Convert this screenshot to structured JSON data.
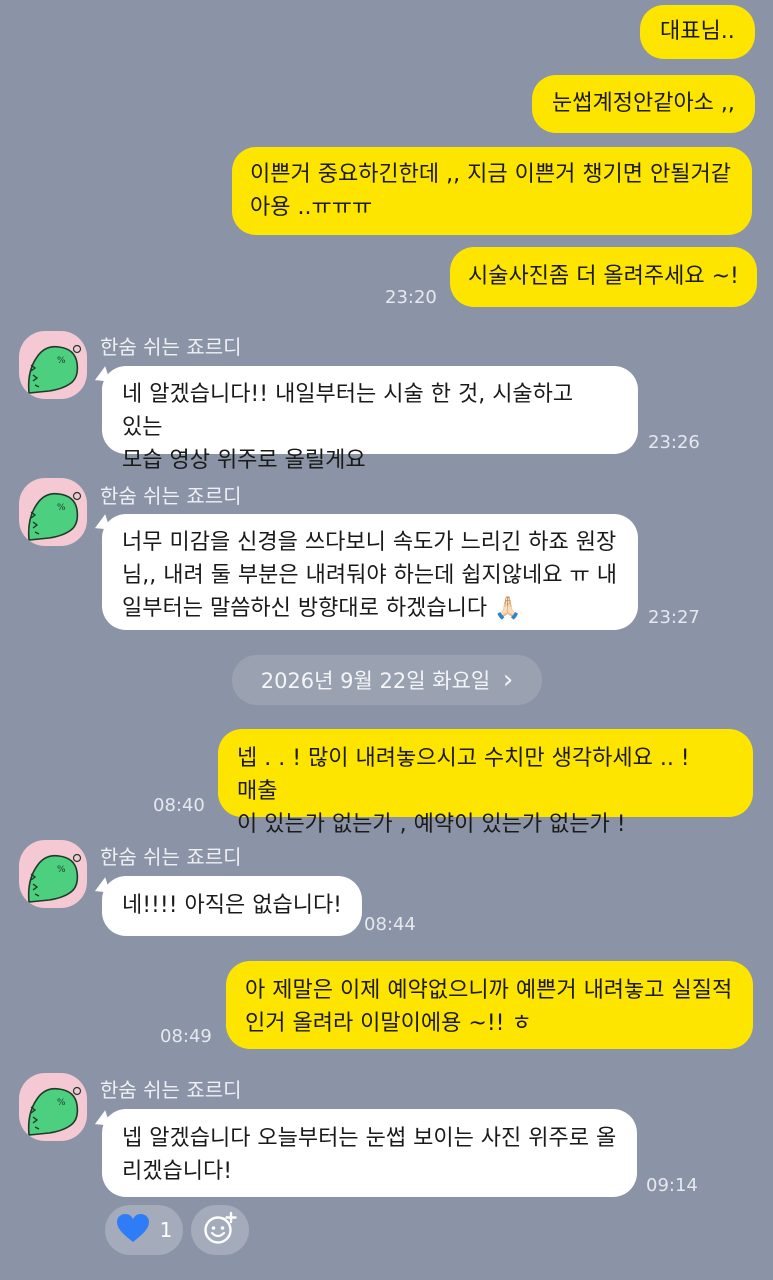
{
  "sender_name": "한숨 쉬는 죠르디",
  "date_divider": "2026년 9월 22일 화요일",
  "date_chevron": "›",
  "messages": [
    {
      "text": "대표님.."
    },
    {
      "text": "눈썹계정안같아소 ,,"
    },
    {
      "text": "이쁜거 중요하긴한데 ,, 지금 이쁜거 챙기면 안될거같\n아용 ..ㅠㅠㅠ"
    },
    {
      "text": "시술사진좀 더 올려주세요 ~!",
      "time": "23:20"
    },
    {
      "text": "네 알겠습니다!! 내일부터는 시술 한 것, 시술하고 있는\n모습 영상 위주로 올릴게요",
      "time": "23:26"
    },
    {
      "text": "너무 미감을 신경을 쓰다보니 속도가 느리긴 하죠 원장\n님,, 내려 둘 부분은 내려둬야 하는데 쉽지않네요 ㅠ 내\n일부터는 말씀하신 방향대로 하겠습니다 🙏🏻",
      "time": "23:27"
    },
    {
      "text": "넵 . . ! 많이 내려놓으시고 수치만 생각하세요 .. ! 매출\n이 있는가 없는가 , 예약이 있는가 없는가 !",
      "time": "08:40"
    },
    {
      "text": "네!!!! 아직은 없습니다!",
      "time": "08:44"
    },
    {
      "text": "아 제말은 이제 예약없으니까 예쁜거 내려놓고 실질적\n인거 올려라 이말이에용 ~!! ㅎ",
      "time": "08:49"
    },
    {
      "text": "넵 알겠습니다 오늘부터는 눈썹 보이는 사진 위주로 올\n리겠습니다!",
      "time": "09:14"
    }
  ],
  "reaction": {
    "icon": "heart-icon",
    "count": "1"
  },
  "colors": {
    "background": "#8b94a6",
    "my_bubble": "#fee500",
    "other_bubble": "#ffffff",
    "avatar_bg": "#f4c9d4",
    "avatar_char": "#4ccf7e",
    "heart": "#2f7df6"
  }
}
